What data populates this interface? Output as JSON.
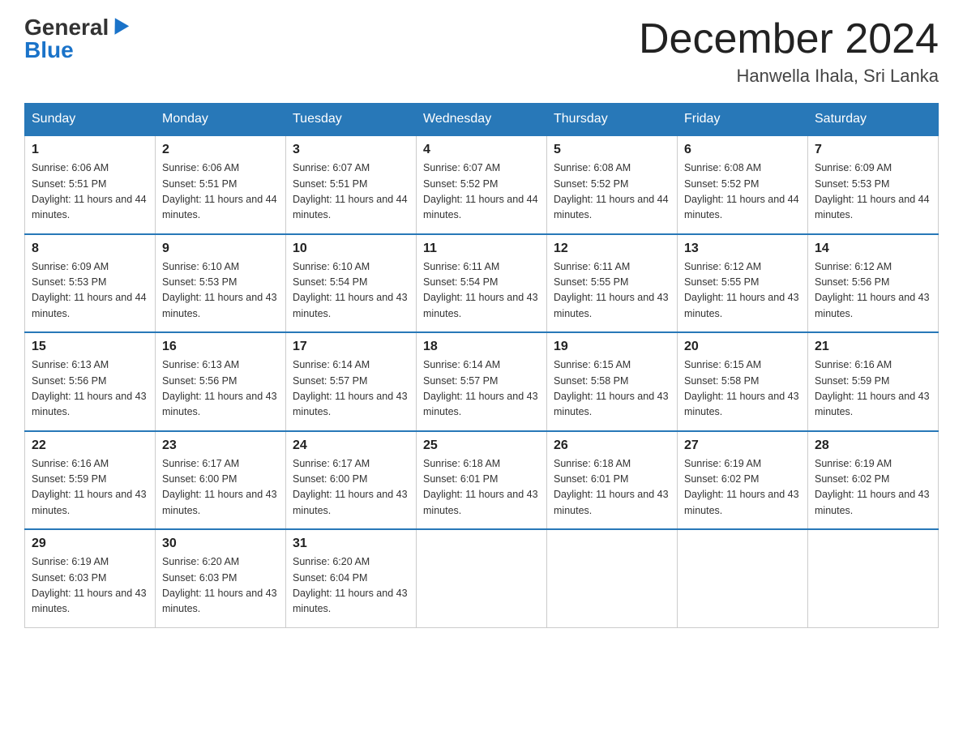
{
  "header": {
    "logo_general": "General",
    "logo_blue": "Blue",
    "month_title": "December 2024",
    "location": "Hanwella Ihala, Sri Lanka"
  },
  "weekdays": [
    "Sunday",
    "Monday",
    "Tuesday",
    "Wednesday",
    "Thursday",
    "Friday",
    "Saturday"
  ],
  "weeks": [
    [
      {
        "day": "1",
        "sunrise": "6:06 AM",
        "sunset": "5:51 PM",
        "daylight": "11 hours and 44 minutes."
      },
      {
        "day": "2",
        "sunrise": "6:06 AM",
        "sunset": "5:51 PM",
        "daylight": "11 hours and 44 minutes."
      },
      {
        "day": "3",
        "sunrise": "6:07 AM",
        "sunset": "5:51 PM",
        "daylight": "11 hours and 44 minutes."
      },
      {
        "day": "4",
        "sunrise": "6:07 AM",
        "sunset": "5:52 PM",
        "daylight": "11 hours and 44 minutes."
      },
      {
        "day": "5",
        "sunrise": "6:08 AM",
        "sunset": "5:52 PM",
        "daylight": "11 hours and 44 minutes."
      },
      {
        "day": "6",
        "sunrise": "6:08 AM",
        "sunset": "5:52 PM",
        "daylight": "11 hours and 44 minutes."
      },
      {
        "day": "7",
        "sunrise": "6:09 AM",
        "sunset": "5:53 PM",
        "daylight": "11 hours and 44 minutes."
      }
    ],
    [
      {
        "day": "8",
        "sunrise": "6:09 AM",
        "sunset": "5:53 PM",
        "daylight": "11 hours and 44 minutes."
      },
      {
        "day": "9",
        "sunrise": "6:10 AM",
        "sunset": "5:53 PM",
        "daylight": "11 hours and 43 minutes."
      },
      {
        "day": "10",
        "sunrise": "6:10 AM",
        "sunset": "5:54 PM",
        "daylight": "11 hours and 43 minutes."
      },
      {
        "day": "11",
        "sunrise": "6:11 AM",
        "sunset": "5:54 PM",
        "daylight": "11 hours and 43 minutes."
      },
      {
        "day": "12",
        "sunrise": "6:11 AM",
        "sunset": "5:55 PM",
        "daylight": "11 hours and 43 minutes."
      },
      {
        "day": "13",
        "sunrise": "6:12 AM",
        "sunset": "5:55 PM",
        "daylight": "11 hours and 43 minutes."
      },
      {
        "day": "14",
        "sunrise": "6:12 AM",
        "sunset": "5:56 PM",
        "daylight": "11 hours and 43 minutes."
      }
    ],
    [
      {
        "day": "15",
        "sunrise": "6:13 AM",
        "sunset": "5:56 PM",
        "daylight": "11 hours and 43 minutes."
      },
      {
        "day": "16",
        "sunrise": "6:13 AM",
        "sunset": "5:56 PM",
        "daylight": "11 hours and 43 minutes."
      },
      {
        "day": "17",
        "sunrise": "6:14 AM",
        "sunset": "5:57 PM",
        "daylight": "11 hours and 43 minutes."
      },
      {
        "day": "18",
        "sunrise": "6:14 AM",
        "sunset": "5:57 PM",
        "daylight": "11 hours and 43 minutes."
      },
      {
        "day": "19",
        "sunrise": "6:15 AM",
        "sunset": "5:58 PM",
        "daylight": "11 hours and 43 minutes."
      },
      {
        "day": "20",
        "sunrise": "6:15 AM",
        "sunset": "5:58 PM",
        "daylight": "11 hours and 43 minutes."
      },
      {
        "day": "21",
        "sunrise": "6:16 AM",
        "sunset": "5:59 PM",
        "daylight": "11 hours and 43 minutes."
      }
    ],
    [
      {
        "day": "22",
        "sunrise": "6:16 AM",
        "sunset": "5:59 PM",
        "daylight": "11 hours and 43 minutes."
      },
      {
        "day": "23",
        "sunrise": "6:17 AM",
        "sunset": "6:00 PM",
        "daylight": "11 hours and 43 minutes."
      },
      {
        "day": "24",
        "sunrise": "6:17 AM",
        "sunset": "6:00 PM",
        "daylight": "11 hours and 43 minutes."
      },
      {
        "day": "25",
        "sunrise": "6:18 AM",
        "sunset": "6:01 PM",
        "daylight": "11 hours and 43 minutes."
      },
      {
        "day": "26",
        "sunrise": "6:18 AM",
        "sunset": "6:01 PM",
        "daylight": "11 hours and 43 minutes."
      },
      {
        "day": "27",
        "sunrise": "6:19 AM",
        "sunset": "6:02 PM",
        "daylight": "11 hours and 43 minutes."
      },
      {
        "day": "28",
        "sunrise": "6:19 AM",
        "sunset": "6:02 PM",
        "daylight": "11 hours and 43 minutes."
      }
    ],
    [
      {
        "day": "29",
        "sunrise": "6:19 AM",
        "sunset": "6:03 PM",
        "daylight": "11 hours and 43 minutes."
      },
      {
        "day": "30",
        "sunrise": "6:20 AM",
        "sunset": "6:03 PM",
        "daylight": "11 hours and 43 minutes."
      },
      {
        "day": "31",
        "sunrise": "6:20 AM",
        "sunset": "6:04 PM",
        "daylight": "11 hours and 43 minutes."
      },
      null,
      null,
      null,
      null
    ]
  ]
}
